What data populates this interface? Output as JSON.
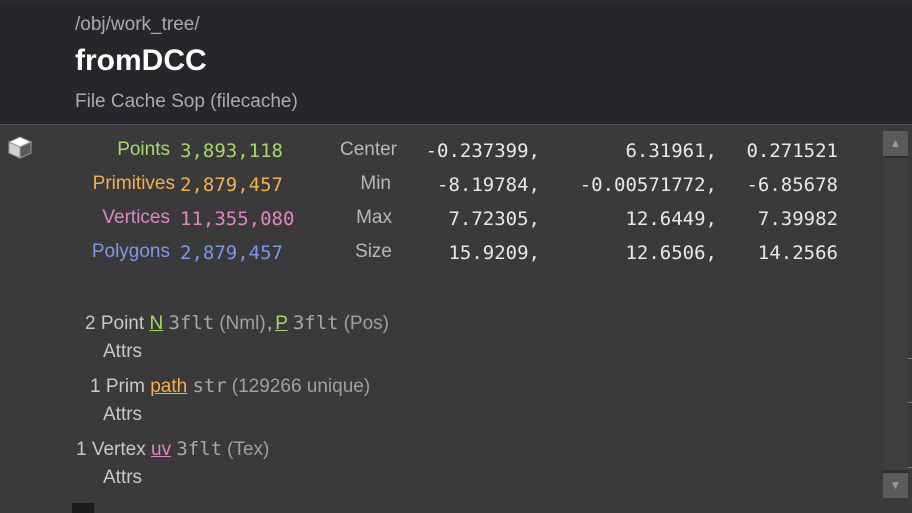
{
  "header": {
    "path": "/obj/work_tree/",
    "title": "fromDCC",
    "subtitle": "File Cache Sop (filecache)"
  },
  "stats": [
    {
      "label": "Points",
      "value": "3,893,118",
      "color": "#a6d96a"
    },
    {
      "label": "Primitives",
      "value": "2,879,457",
      "color": "#f2b04f"
    },
    {
      "label": "Vertices",
      "value": "11,355,080",
      "color": "#e087c2"
    },
    {
      "label": "Polygons",
      "value": "2,879,457",
      "color": "#7f97e8"
    }
  ],
  "bbox": [
    {
      "label": "Center",
      "x": "-0.237399,",
      "y": "6.31961,",
      "z": "0.271521"
    },
    {
      "label": "Min",
      "x": "-8.19784,",
      "y": "-0.00571772,",
      "z": "-6.85678"
    },
    {
      "label": "Max",
      "x": "7.72305,",
      "y": "12.6449,",
      "z": "7.39982"
    },
    {
      "label": "Size",
      "x": "15.9209,",
      "y": "12.6506,",
      "z": "14.2566"
    }
  ],
  "attributes": {
    "point": {
      "count_label": "2 Point",
      "sub_label": "Attrs",
      "attr1_name": "N",
      "attr1_type": "3flt",
      "attr1_info": "(Nml)",
      "separator": ",",
      "attr2_name": "P",
      "attr2_type": "3flt",
      "attr2_info": "(Pos)"
    },
    "prim": {
      "count_label": "1 Prim",
      "sub_label": "Attrs",
      "attr1_name": "path",
      "attr1_type": "str",
      "attr1_info": "(129266 unique)"
    },
    "vertex": {
      "count_label": "1 Vertex",
      "sub_label": "Attrs",
      "attr1_name": "uv",
      "attr1_type": "3flt",
      "attr1_info": "(Tex)"
    }
  },
  "colors": {
    "point_attr": "#a6d96a",
    "prim_attr": "#f2b04f",
    "vertex_attr": "#e087c2"
  },
  "icons": {
    "geometry": "cube-icon",
    "scroll_up": "arrow-up-icon",
    "scroll_down": "arrow-down-icon"
  },
  "scroll": {
    "up": "▲",
    "down": "▼"
  }
}
